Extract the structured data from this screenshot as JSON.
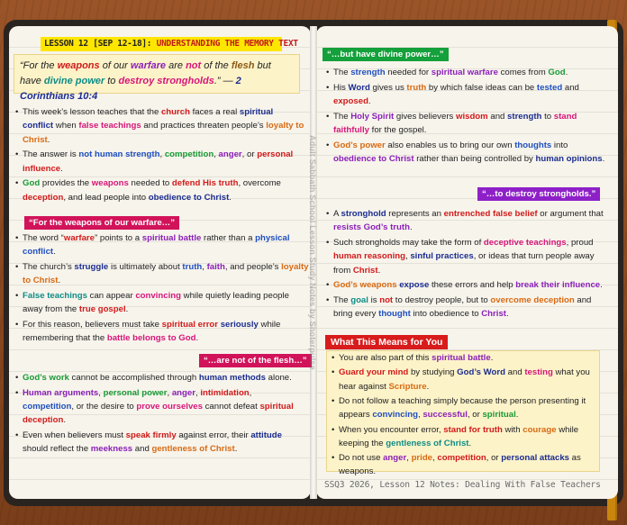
{
  "lesson_title": {
    "label": "LESSON 12 [SEP 12-18]:",
    "topic": " UNDERSTANDING THE MEMORY TEXT"
  },
  "verse": {
    "p1": "“For the ",
    "weapons": "weapons",
    "p2": " of our ",
    "warfare": "warfare",
    "p3": " are ",
    "not": "not",
    "p4": " of the ",
    "flesh": "flesh",
    "p5": " but have ",
    "divine_power": "divine power",
    "p6": " to ",
    "destroy": "destroy strongholds",
    "p7": ".” — ",
    "ref": "2 Corinthians 10:4"
  },
  "left_notes_1": [
    {
      "a": "This week’s lesson teaches that the ",
      "b": "church",
      "c": " faces a real ",
      "d": "spiritual conflict",
      "e": " when ",
      "f": "false teachings",
      "g": " and practices threaten people’s ",
      "h": "loyalty to Christ",
      "i": "."
    },
    {
      "a": "The answer is ",
      "b": "not human strength",
      "c": ", ",
      "d": "competition",
      "e": ", ",
      "f": "anger",
      "g": ", or ",
      "h": "personal influence",
      "i": "."
    },
    {
      "a": "",
      "b": "God",
      "c": " provides the ",
      "d": "weapons",
      "e": " needed to ",
      "f": "defend His truth",
      "g": ", overcome ",
      "h": "deception",
      "i": ", and lead people into ",
      "j": "obedience to Christ",
      "k": "."
    }
  ],
  "tags": {
    "weapons": "“For the weapons of our warfare…”",
    "not_flesh": "“…are not of the flesh…”",
    "divine": "“…but have divine power…”",
    "strongholds": "“…to destroy strongholds.”"
  },
  "left_notes_2": [
    {
      "a": "The word “",
      "b": "warfare",
      "c": "” points to a ",
      "d": "spiritual battle",
      "e": " rather than a ",
      "f": "physical conflict",
      "g": "."
    },
    {
      "a": "The church’s ",
      "b": "struggle",
      "c": " is ultimately about ",
      "d": "truth",
      "e": ", ",
      "f": "faith",
      "g": ", and people’s ",
      "h": "loyalty to Christ",
      "i": "."
    },
    {
      "a": "",
      "b": "False teachings",
      "c": " can appear ",
      "d": "convincing",
      "e": " while quietly leading people away from the ",
      "f": "true gospel",
      "g": "."
    },
    {
      "a": "For this reason, believers must take ",
      "b": "spiritual error",
      "c": " ",
      "d": "seriously",
      "e": " while remembering that the ",
      "f": "battle belongs to God",
      "g": "."
    }
  ],
  "left_notes_3": [
    {
      "a": "",
      "b": "God’s work",
      "c": " cannot be accomplished through ",
      "d": "human methods",
      "e": " alone."
    },
    {
      "a": "",
      "b": "Human arguments",
      "c": ", ",
      "d": "personal power",
      "e": ", ",
      "f": "anger",
      "g": ", ",
      "h": "intimidation",
      "i": ", ",
      "j": "competition",
      "k": ", or the desire to ",
      "l": "prove ourselves",
      "m": " cannot defeat ",
      "n": "spiritual deception",
      "o": "."
    },
    {
      "a": "Even when believers must ",
      "b": "speak firmly",
      "c": " against error, their ",
      "d": "attitude",
      "e": " should reflect the ",
      "f": "meekness",
      "g": " and ",
      "h": "gentleness of Christ",
      "i": "."
    }
  ],
  "right_notes_1": [
    {
      "a": "The ",
      "b": "strength",
      "c": " needed for ",
      "d": "spiritual warfare",
      "e": " comes from ",
      "f": "God",
      "g": "."
    },
    {
      "a": "His ",
      "b": "Word",
      "c": " gives us ",
      "d": "truth",
      "e": " by which false ideas can be ",
      "f": "tested",
      "g": " and ",
      "h": "exposed",
      "i": "."
    },
    {
      "a": "The ",
      "b": "Holy Spirit",
      "c": " gives believers ",
      "d": "wisdom",
      "e": " and ",
      "f": "strength",
      "g": " to ",
      "h": "stand faithfully",
      "i": " for the gospel."
    },
    {
      "a": "",
      "b": "God’s power",
      "c": " also enables us to bring our own ",
      "d": "thoughts",
      "e": " into ",
      "f": "obedience to Christ",
      "g": " rather than being controlled by ",
      "h": "human opinions",
      "i": "."
    }
  ],
  "right_notes_2": [
    {
      "a": "A ",
      "b": "stronghold",
      "c": " represents an ",
      "d": "entrenched false belief",
      "e": " or argument that ",
      "f": "resists God’s truth",
      "g": "."
    },
    {
      "a": "Such strongholds may take the form of ",
      "b": "deceptive teachings",
      "c": ", proud ",
      "d": "human reasoning",
      "e": ", ",
      "f": "sinful practices",
      "g": ", or ideas that turn people away from ",
      "h": "Christ",
      "i": "."
    },
    {
      "a": "",
      "b": "God’s weapons",
      "c": " ",
      "d": "expose",
      "e": " these errors and help ",
      "f": "break their influence",
      "g": "."
    },
    {
      "a": "The ",
      "b": "goal",
      "c": " is ",
      "d": "not",
      "e": " to destroy people, but to ",
      "f": "overcome deception",
      "g": " and bring every ",
      "h": "thought",
      "i": " into obedience to ",
      "j": "Christ",
      "k": "."
    }
  ],
  "meaning": {
    "heading": "What This Means for You",
    "items": [
      {
        "a": "You are also part of this ",
        "b": "spiritual battle",
        "c": "."
      },
      {
        "a": "",
        "b": "Guard your mind",
        "c": " by studying ",
        "d": "God’s Word",
        "e": " and ",
        "f": "testing",
        "g": " what you hear against ",
        "h": "Scripture",
        "i": "."
      },
      {
        "a": "Do not follow a teaching simply because the person presenting it appears ",
        "b": "convincing",
        "c": ", ",
        "d": "successful",
        "e": ", or ",
        "f": "spiritual",
        "g": "."
      },
      {
        "a": "When you encounter error, ",
        "b": "stand for truth",
        "c": " with ",
        "d": "courage",
        "e": " while keeping the ",
        "f": "gentleness of Christ",
        "g": "."
      },
      {
        "a": "Do not use ",
        "b": "anger",
        "c": ", ",
        "d": "pride",
        "e": ", ",
        "f": "competition",
        "g": ", or ",
        "h": "personal attacks",
        "i": " as weapons."
      }
    ]
  },
  "watermark": "Adult Sabbath School Lesson Study Notes by Shoterpulse",
  "footer": "SSQ3 2026, Lesson 12 Notes: Dealing With False Teachers"
}
